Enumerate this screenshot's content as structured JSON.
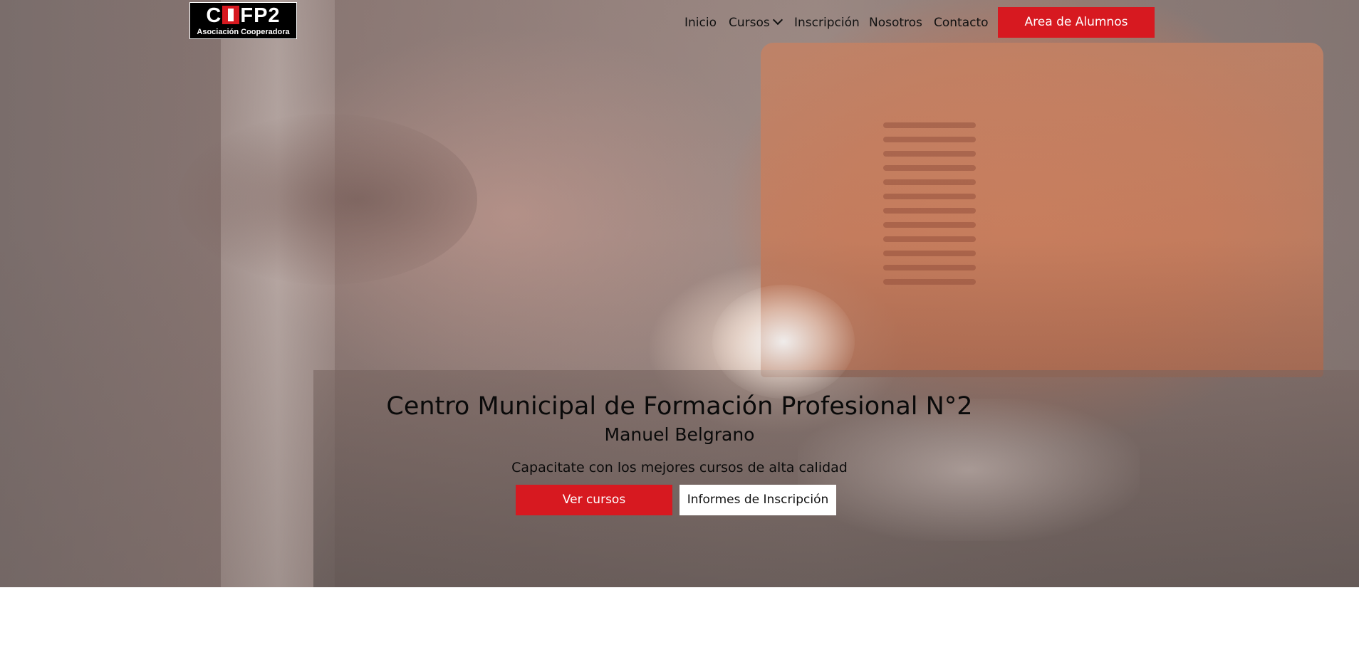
{
  "logo": {
    "main_prefix": "C",
    "main_suffix": "FP2",
    "subtitle": "Asociación Cooperadora"
  },
  "nav": {
    "items": [
      {
        "label": "Inicio"
      },
      {
        "label": "Cursos",
        "has_dropdown": true,
        "icon": "chevron-down-icon"
      },
      {
        "label": "Inscripción"
      },
      {
        "label": "Nosotros"
      },
      {
        "label": "Contacto"
      }
    ],
    "cta_label": "Area de Alumnos"
  },
  "hero": {
    "title": "Centro Municipal de Formación Profesional N°2",
    "subtitle": "Manuel Belgrano",
    "tagline": "Capacitate con los mejores cursos de alta calidad",
    "primary_button": "Ver cursos",
    "secondary_button": "Informes de Inscripción"
  },
  "colors": {
    "accent": "#d71920",
    "text": "#0a0a0a",
    "page_background": "#ffffff"
  }
}
